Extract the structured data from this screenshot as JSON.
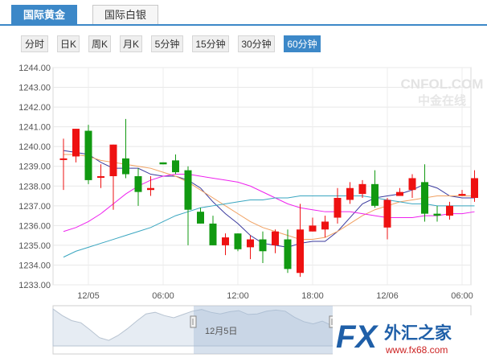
{
  "tabs": [
    {
      "label": "国际黄金",
      "active": true
    },
    {
      "label": "国际白银",
      "active": false
    }
  ],
  "periods": [
    "分时",
    "日K",
    "周K",
    "月K",
    "5分钟",
    "15分钟",
    "30分钟",
    "60分钟"
  ],
  "selected_period": "60分钟",
  "watermark": {
    "top": "CNFOL.COM",
    "bottom": "中金在线"
  },
  "logo": {
    "brand": "FX",
    "cn": "外汇之家",
    "url": "www.fx68.com"
  },
  "navigator": {
    "label": "12月5日"
  },
  "colors": {
    "up": "#ee1111",
    "down": "#119911",
    "ma5": "#3a3a9e",
    "ma10": "#f0a060",
    "ma20": "#ee22ee",
    "ma30": "#3aa6c0"
  },
  "chart_data": {
    "type": "candlestick",
    "y_ticks": [
      "1244.00",
      "1243.00",
      "1242.00",
      "1241.00",
      "1240.00",
      "1239.00",
      "1238.00",
      "1237.00",
      "1236.00",
      "1235.00",
      "1234.00",
      "1233.00"
    ],
    "ylim": [
      1233.0,
      1244.0
    ],
    "x_labels": [
      "12/05",
      "06:00",
      "12:00",
      "18:00",
      "12/06",
      "06:00"
    ],
    "candles": [
      {
        "o": 1239.4,
        "h": 1240.4,
        "l": 1237.8,
        "c": 1239.4
      },
      {
        "o": 1239.5,
        "h": 1240.9,
        "l": 1239.2,
        "c": 1240.9
      },
      {
        "o": 1240.8,
        "h": 1241.1,
        "l": 1238.1,
        "c": 1238.3
      },
      {
        "o": 1238.5,
        "h": 1239.1,
        "l": 1237.9,
        "c": 1238.5
      },
      {
        "o": 1238.5,
        "h": 1240.1,
        "l": 1236.8,
        "c": 1240.1
      },
      {
        "o": 1239.4,
        "h": 1241.4,
        "l": 1238.4,
        "c": 1238.6
      },
      {
        "o": 1238.5,
        "h": 1238.9,
        "l": 1237.0,
        "c": 1237.7
      },
      {
        "o": 1237.8,
        "h": 1238.5,
        "l": 1237.5,
        "c": 1237.9
      },
      {
        "o": 1239.2,
        "h": 1239.2,
        "l": 1239.1,
        "c": 1239.1
      },
      {
        "o": 1239.3,
        "h": 1239.6,
        "l": 1238.6,
        "c": 1238.7
      },
      {
        "o": 1238.8,
        "h": 1239.0,
        "l": 1235.0,
        "c": 1236.8
      },
      {
        "o": 1236.7,
        "h": 1236.9,
        "l": 1236.1,
        "c": 1236.1
      },
      {
        "o": 1236.1,
        "h": 1236.5,
        "l": 1235.0,
        "c": 1235.0
      },
      {
        "o": 1235.0,
        "h": 1235.6,
        "l": 1234.5,
        "c": 1235.4
      },
      {
        "o": 1235.6,
        "h": 1235.6,
        "l": 1234.7,
        "c": 1234.8
      },
      {
        "o": 1234.9,
        "h": 1235.5,
        "l": 1234.3,
        "c": 1235.3
      },
      {
        "o": 1235.3,
        "h": 1235.7,
        "l": 1234.1,
        "c": 1234.7
      },
      {
        "o": 1235.0,
        "h": 1235.8,
        "l": 1234.6,
        "c": 1235.7
      },
      {
        "o": 1235.3,
        "h": 1235.8,
        "l": 1233.6,
        "c": 1233.8
      },
      {
        "o": 1233.6,
        "h": 1237.1,
        "l": 1233.4,
        "c": 1235.8
      },
      {
        "o": 1235.7,
        "h": 1236.4,
        "l": 1235.7,
        "c": 1236.0
      },
      {
        "o": 1235.8,
        "h": 1236.5,
        "l": 1235.4,
        "c": 1236.2
      },
      {
        "o": 1236.4,
        "h": 1237.9,
        "l": 1236.1,
        "c": 1237.4
      },
      {
        "o": 1237.3,
        "h": 1238.2,
        "l": 1237.1,
        "c": 1237.9
      },
      {
        "o": 1237.6,
        "h": 1238.3,
        "l": 1237.4,
        "c": 1238.1
      },
      {
        "o": 1238.1,
        "h": 1238.8,
        "l": 1236.9,
        "c": 1237.0
      },
      {
        "o": 1235.9,
        "h": 1237.4,
        "l": 1235.3,
        "c": 1237.3
      },
      {
        "o": 1237.5,
        "h": 1237.9,
        "l": 1237.5,
        "c": 1237.7
      },
      {
        "o": 1237.8,
        "h": 1238.6,
        "l": 1237.4,
        "c": 1238.4
      },
      {
        "o": 1238.2,
        "h": 1239.1,
        "l": 1236.2,
        "c": 1236.6
      },
      {
        "o": 1236.6,
        "h": 1237.0,
        "l": 1236.2,
        "c": 1236.5
      },
      {
        "o": 1236.5,
        "h": 1237.2,
        "l": 1236.3,
        "c": 1237.0
      },
      {
        "o": 1237.6,
        "h": 1237.8,
        "l": 1237.5,
        "c": 1237.6
      },
      {
        "o": 1237.4,
        "h": 1238.8,
        "l": 1237.2,
        "c": 1238.4
      }
    ],
    "ma_lines": [
      {
        "name": "MA5",
        "values": [
          1239.8,
          1239.7,
          1239.6,
          1239.2,
          1238.9,
          1238.9,
          1238.9,
          1238.6,
          1238.5,
          1238.5,
          1238.3,
          1237.9,
          1237.2,
          1236.6,
          1236.1,
          1235.5,
          1235.1,
          1235.0,
          1234.9,
          1235.1,
          1235.2,
          1235.2,
          1235.7,
          1236.4,
          1237.1,
          1237.4,
          1237.5,
          1237.6,
          1237.8,
          1238.1,
          1237.9,
          1237.5,
          1237.4,
          1237.4
        ]
      },
      {
        "name": "MA10",
        "values": [
          1239.6,
          1239.6,
          1239.5,
          1239.3,
          1239.2,
          1239.1,
          1239.0,
          1238.9,
          1238.7,
          1238.5,
          1238.2,
          1237.8,
          1237.4,
          1237.0,
          1236.6,
          1236.2,
          1235.9,
          1235.7,
          1235.5,
          1235.3,
          1235.3,
          1235.4,
          1235.7,
          1236.1,
          1236.5,
          1236.8,
          1237.0,
          1237.2,
          1237.3,
          1237.4,
          1237.5,
          1237.5,
          1237.5,
          1237.5
        ]
      },
      {
        "name": "MA20",
        "values": [
          1235.7,
          1235.9,
          1236.2,
          1236.6,
          1237.1,
          1237.6,
          1238.0,
          1238.3,
          1238.5,
          1238.6,
          1238.6,
          1238.5,
          1238.4,
          1238.3,
          1238.2,
          1238.0,
          1237.7,
          1237.4,
          1237.1,
          1236.9,
          1236.8,
          1236.7,
          1236.7,
          1236.7,
          1236.6,
          1236.5,
          1236.4,
          1236.4,
          1236.4,
          1236.5,
          1236.5,
          1236.6,
          1236.6,
          1236.7
        ]
      },
      {
        "name": "MA30",
        "values": [
          1234.4,
          1234.7,
          1234.9,
          1235.1,
          1235.3,
          1235.5,
          1235.7,
          1235.9,
          1236.2,
          1236.5,
          1236.7,
          1236.9,
          1237.0,
          1237.1,
          1237.2,
          1237.3,
          1237.3,
          1237.4,
          1237.4,
          1237.5,
          1237.5,
          1237.5,
          1237.5,
          1237.5,
          1237.5,
          1237.4,
          1237.3,
          1237.2,
          1237.1,
          1237.1,
          1237.0,
          1237.0,
          1237.0,
          1237.0
        ]
      }
    ],
    "navigator_series": [
      1243.2,
      1242.0,
      1241.1,
      1240.7,
      1239.4,
      1238.0,
      1237.5,
      1238.4,
      1239.6,
      1241.0,
      1242.3,
      1242.6,
      1242.0,
      1241.6,
      1242.2,
      1242.8,
      1243.1,
      1242.6,
      1242.3,
      1242.7,
      1242.9,
      1242.2,
      1242.3,
      1242.8,
      1243.0,
      1242.8,
      1241.7,
      1240.9,
      1240.5,
      1241.0,
      1240.2,
      1239.6,
      1240.0,
      1239.5,
      1239.0,
      1239.7,
      1239.4,
      1239.2,
      1239.5,
      1238.9,
      1239.3,
      1238.6,
      1237.8,
      1237.6,
      1237.2,
      1237.0
    ],
    "grid": true
  }
}
